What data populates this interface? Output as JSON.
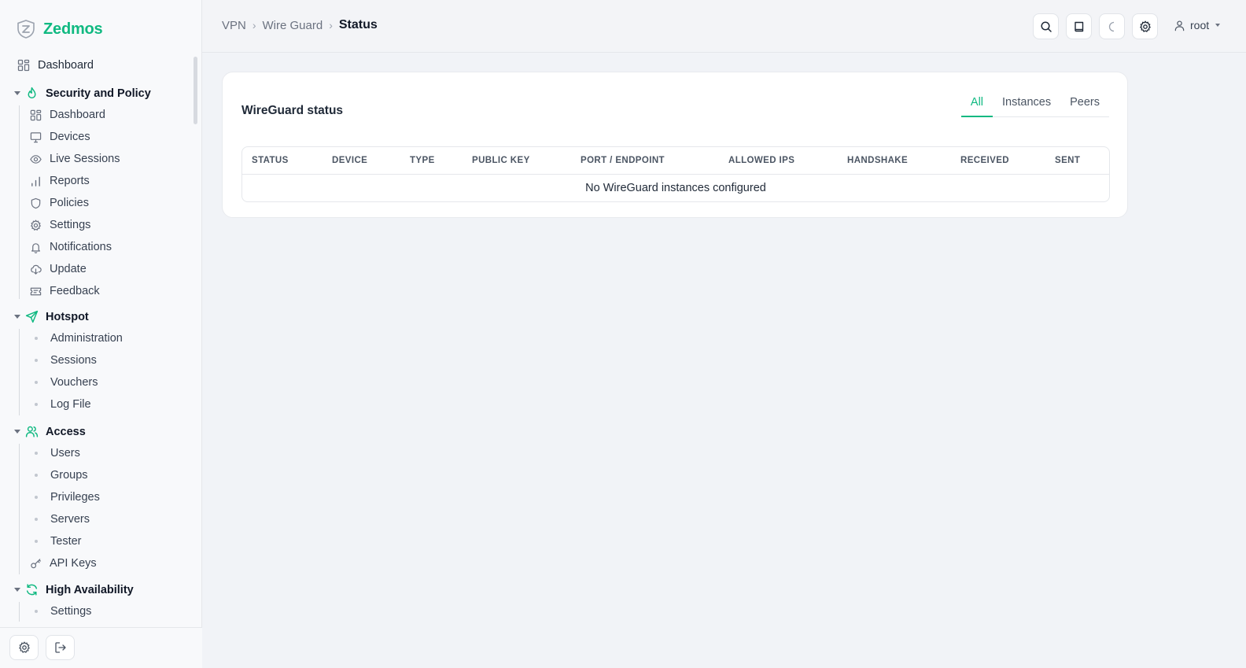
{
  "brand": {
    "name": "Zedmos"
  },
  "sidebar": {
    "top_item": {
      "label": "Dashboard",
      "icon": "dashboard-icon"
    },
    "groups": [
      {
        "label": "Security and Policy",
        "icon": "flame-icon",
        "items": [
          {
            "label": "Dashboard",
            "icon": "dashboard-icon"
          },
          {
            "label": "Devices",
            "icon": "monitor-icon"
          },
          {
            "label": "Live Sessions",
            "icon": "eye-icon"
          },
          {
            "label": "Reports",
            "icon": "bar-chart-icon"
          },
          {
            "label": "Policies",
            "icon": "shield-icon"
          },
          {
            "label": "Settings",
            "icon": "gear-icon"
          },
          {
            "label": "Notifications",
            "icon": "bell-icon"
          },
          {
            "label": "Update",
            "icon": "cloud-download-icon"
          },
          {
            "label": "Feedback",
            "icon": "ticket-icon"
          }
        ]
      },
      {
        "label": "Hotspot",
        "icon": "send-icon",
        "items": [
          {
            "label": "Administration"
          },
          {
            "label": "Sessions"
          },
          {
            "label": "Vouchers"
          },
          {
            "label": "Log File"
          }
        ]
      },
      {
        "label": "Access",
        "icon": "users-icon",
        "items": [
          {
            "label": "Users"
          },
          {
            "label": "Groups"
          },
          {
            "label": "Privileges"
          },
          {
            "label": "Servers"
          },
          {
            "label": "Tester"
          },
          {
            "label": "API Keys",
            "icon": "key-icon"
          }
        ]
      },
      {
        "label": "High Availability",
        "icon": "refresh-icon",
        "items": [
          {
            "label": "Settings"
          }
        ]
      }
    ]
  },
  "breadcrumb": {
    "items": [
      "VPN",
      "Wire Guard"
    ],
    "current": "Status"
  },
  "header": {
    "user": "root"
  },
  "card": {
    "title": "WireGuard status",
    "tabs": [
      "All",
      "Instances",
      "Peers"
    ],
    "active_tab": "All",
    "columns": [
      "STATUS",
      "DEVICE",
      "TYPE",
      "PUBLIC KEY",
      "PORT / ENDPOINT",
      "ALLOWED IPS",
      "HANDSHAKE",
      "RECEIVED",
      "SENT"
    ],
    "empty_message": "No WireGuard instances configured"
  },
  "colors": {
    "accent": "#10b981",
    "background": "#f1f3f7"
  }
}
